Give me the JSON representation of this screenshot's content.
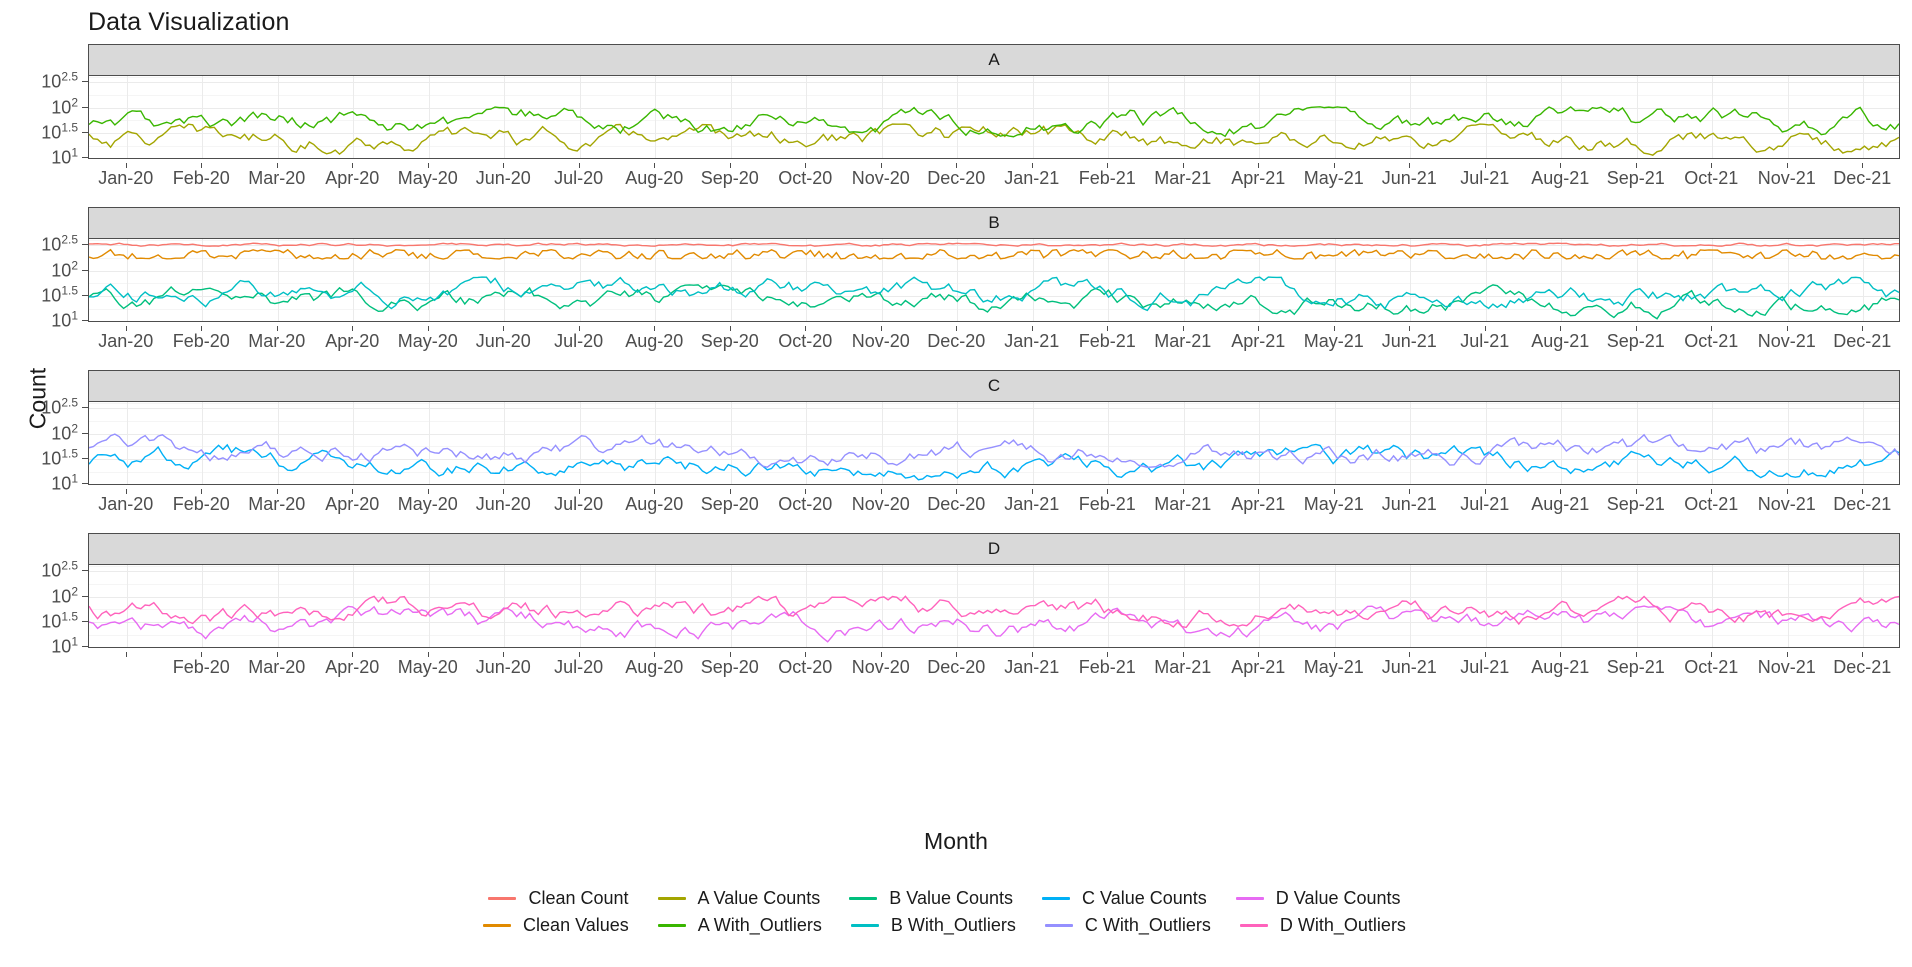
{
  "title": "Data Visualization",
  "axes": {
    "y_title": "Count",
    "x_title": "Month",
    "y_ticks": [
      {
        "base": "10",
        "exp": "1"
      },
      {
        "base": "10",
        "exp": "1.5"
      },
      {
        "base": "10",
        "exp": "2"
      },
      {
        "base": "10",
        "exp": "2.5"
      }
    ],
    "x_ticks": [
      "Jan-20",
      "Feb-20",
      "Mar-20",
      "Apr-20",
      "May-20",
      "Jun-20",
      "Jul-20",
      "Aug-20",
      "Sep-20",
      "Oct-20",
      "Nov-20",
      "Dec-20",
      "Jan-21",
      "Feb-21",
      "Mar-21",
      "Apr-21",
      "May-21",
      "Jun-21",
      "Jul-21",
      "Aug-21",
      "Sep-21",
      "Oct-21",
      "Nov-21",
      "Dec-21"
    ],
    "x_ticks_panel_d": [
      "",
      "Feb-20",
      "Mar-20",
      "Apr-20",
      "May-20",
      "Jun-20",
      "Jul-20",
      "Aug-20",
      "Sep-20",
      "Oct-20",
      "Nov-20",
      "Dec-20",
      "Jan-21",
      "Feb-21",
      "Mar-21",
      "Apr-21",
      "May-21",
      "Jun-21",
      "Jul-21",
      "Aug-21",
      "Sep-21",
      "Oct-21",
      "Nov-21",
      "Dec-21"
    ]
  },
  "facets": [
    {
      "label": "A"
    },
    {
      "label": "B"
    },
    {
      "label": "C"
    },
    {
      "label": "D"
    }
  ],
  "legend": {
    "rows": [
      [
        {
          "label": "Clean Count",
          "color": "#F8766D"
        },
        {
          "label": "A Value Counts",
          "color": "#A3A500"
        },
        {
          "label": "B Value Counts",
          "color": "#00BF7D"
        },
        {
          "label": "C Value Counts",
          "color": "#00B0F6"
        },
        {
          "label": "D Value Counts",
          "color": "#E76BF3"
        }
      ],
      [
        {
          "label": "Clean Values",
          "color": "#E18A00"
        },
        {
          "label": "A With_Outliers",
          "color": "#39B600"
        },
        {
          "label": "B With_Outliers",
          "color": "#00BFC4"
        },
        {
          "label": "C With_Outliers",
          "color": "#9590FF"
        },
        {
          "label": "D With_Outliers",
          "color": "#FF62BC"
        }
      ]
    ]
  },
  "chart_data": {
    "type": "line",
    "title": "Data Visualization",
    "xlabel": "Month",
    "ylabel": "Count",
    "y_scale": "log10",
    "ylim": [
      10,
      400
    ],
    "y_tick_values": [
      10,
      31.62,
      100,
      316.23
    ],
    "y_tick_labels": [
      "10^1",
      "10^1.5",
      "10^2",
      "10^2.5"
    ],
    "x_range": [
      "Jan-20",
      "Dec-21"
    ],
    "x_tick_labels": [
      "Jan-20",
      "Feb-20",
      "Mar-20",
      "Apr-20",
      "May-20",
      "Jun-20",
      "Jul-20",
      "Aug-20",
      "Sep-20",
      "Oct-20",
      "Nov-20",
      "Dec-20",
      "Jan-21",
      "Feb-21",
      "Mar-21",
      "Apr-21",
      "May-21",
      "Jun-21",
      "Jul-21",
      "Aug-21",
      "Sep-21",
      "Oct-21",
      "Nov-21",
      "Dec-21"
    ],
    "grid": true,
    "legend_position": "bottom",
    "facet_labels": [
      "A",
      "B",
      "C",
      "D"
    ],
    "panels": [
      {
        "facet": "A",
        "series": [
          {
            "name": "A Value Counts",
            "color": "#A3A500",
            "mean": 26,
            "min": 10,
            "max": 45
          },
          {
            "name": "A With_Outliers",
            "color": "#39B600",
            "mean": 60,
            "min": 22,
            "max": 100
          }
        ]
      },
      {
        "facet": "B",
        "series": [
          {
            "name": "Clean Count",
            "color": "#F8766D",
            "mean": 320,
            "min": 300,
            "max": 345
          },
          {
            "name": "Clean Values",
            "color": "#E18A00",
            "mean": 205,
            "min": 165,
            "max": 255
          },
          {
            "name": "B Value Counts",
            "color": "#00BF7D",
            "mean": 26,
            "min": 10,
            "max": 50
          },
          {
            "name": "B With_Outliers",
            "color": "#00BFC4",
            "mean": 38,
            "min": 14,
            "max": 72
          }
        ]
      },
      {
        "facet": "C",
        "series": [
          {
            "name": "C Value Counts",
            "color": "#00B0F6",
            "mean": 28,
            "min": 10,
            "max": 58
          },
          {
            "name": "C With_Outliers",
            "color": "#9590FF",
            "mean": 48,
            "min": 20,
            "max": 95
          }
        ]
      },
      {
        "facet": "D",
        "series": [
          {
            "name": "D Value Counts",
            "color": "#E76BF3",
            "mean": 30,
            "min": 10,
            "max": 62
          },
          {
            "name": "D With_Outliers",
            "color": "#FF62BC",
            "mean": 52,
            "min": 22,
            "max": 98
          }
        ]
      }
    ]
  }
}
